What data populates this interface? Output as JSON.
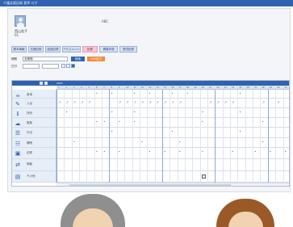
{
  "window": {
    "title": "介護支援記録 夏季 ログ"
  },
  "profile": {
    "name": "西山花子",
    "id": "01",
    "code": "ABC"
  },
  "tabs": [
    "基本情報",
    "支援記録",
    "経過記録",
    "アセスメント",
    "記録",
    "健康状態",
    "提供記録"
  ],
  "filters": {
    "period_label": "期間",
    "period_value": "全期間",
    "search_button": "検索",
    "csv_button": "CSV出力",
    "date_label": "日付",
    "from_value": "",
    "to_value": ""
  },
  "grid": {
    "date_header": "2023",
    "days": [
      "1",
      "2",
      "3",
      "4",
      "5",
      "6",
      "7",
      "8",
      "9",
      "10",
      "11",
      "12",
      "13",
      "14",
      "15",
      "16",
      "17",
      "18",
      "19",
      "20",
      "21",
      "22",
      "23",
      "24",
      "25",
      "26",
      "27",
      "28",
      "29",
      "30",
      "31"
    ],
    "rows": [
      {
        "label": "食事"
      },
      {
        "label": "入浴"
      },
      {
        "label": "排泄"
      },
      {
        "label": "服薬"
      },
      {
        "label": "外出"
      },
      {
        "label": "睡眠"
      },
      {
        "label": "記録"
      },
      {
        "label": "移動"
      },
      {
        "label": "その他"
      }
    ]
  },
  "colors": {
    "titlebar": "#2f63b0",
    "accent": "#2f63b0",
    "pink_tab": "#f7c7d6",
    "orange_button": "#f08c3a",
    "row_head": "#e6eef8"
  }
}
